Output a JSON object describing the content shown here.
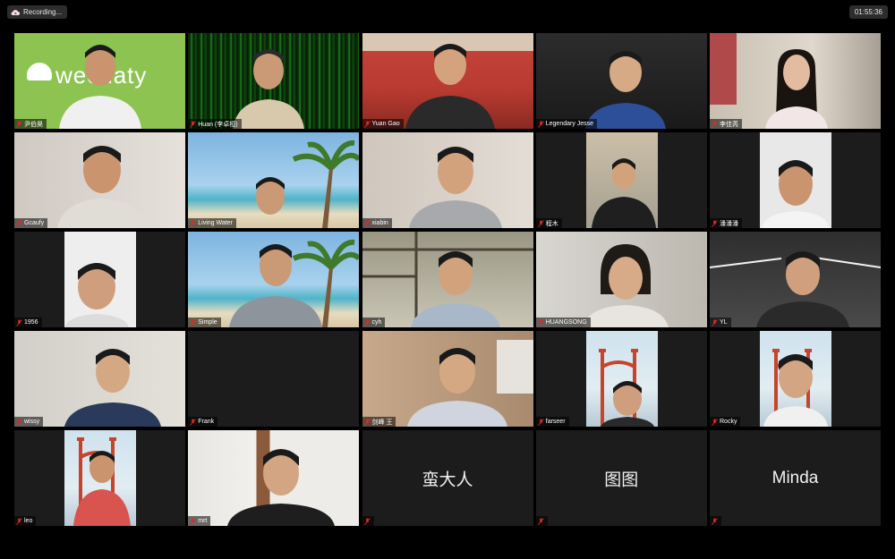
{
  "recording": {
    "label": "Recording..."
  },
  "timer": {
    "value": "01:55:36"
  },
  "participants": [
    {
      "name": "尹伯昊",
      "muted": true,
      "video": true
    },
    {
      "name": "Huan (李卓桓)",
      "muted": true,
      "video": true
    },
    {
      "name": "Yuan Gao",
      "muted": true,
      "video": true,
      "active_speaker": true
    },
    {
      "name": "Legendary Jesse",
      "muted": true,
      "video": true
    },
    {
      "name": "李佳芮",
      "muted": true,
      "video": true
    },
    {
      "name": "Gcaufy",
      "muted": true,
      "video": true
    },
    {
      "name": "Living Water",
      "muted": true,
      "video": true
    },
    {
      "name": "xiabin",
      "muted": true,
      "video": true
    },
    {
      "name": "程木",
      "muted": true,
      "video": true
    },
    {
      "name": "潘潘潘",
      "muted": true,
      "video": true
    },
    {
      "name": "1956",
      "muted": true,
      "video": true
    },
    {
      "name": "Simple",
      "muted": true,
      "video": true
    },
    {
      "name": "cyh",
      "muted": true,
      "video": true
    },
    {
      "name": "HUANGSONG",
      "muted": true,
      "video": true
    },
    {
      "name": "YL",
      "muted": true,
      "video": true
    },
    {
      "name": "wissy",
      "muted": true,
      "video": true
    },
    {
      "name": "Frank",
      "muted": true,
      "video": false
    },
    {
      "name": "剑峰 王",
      "muted": true,
      "video": true
    },
    {
      "name": "farseer",
      "muted": true,
      "video": true
    },
    {
      "name": "Rocky",
      "muted": true,
      "video": true
    },
    {
      "name": "leo",
      "muted": true,
      "video": true
    },
    {
      "name": "mrt",
      "muted": true,
      "video": true
    },
    {
      "name": "蛮大人",
      "muted": true,
      "video": false,
      "display_name_only": true
    },
    {
      "name": "图图",
      "muted": true,
      "video": false,
      "display_name_only": true
    },
    {
      "name": "Minda",
      "muted": true,
      "video": false,
      "display_name_only": true
    }
  ],
  "background_text": {
    "wechaty_logo": "wechaty"
  },
  "icons": {
    "recording": "cloud-record-icon",
    "mute": "mic-muted-icon"
  },
  "colors": {
    "active_speaker_border": "#d9e26b",
    "mute_icon": "#e02828",
    "wechaty_green": "#8dc451"
  }
}
